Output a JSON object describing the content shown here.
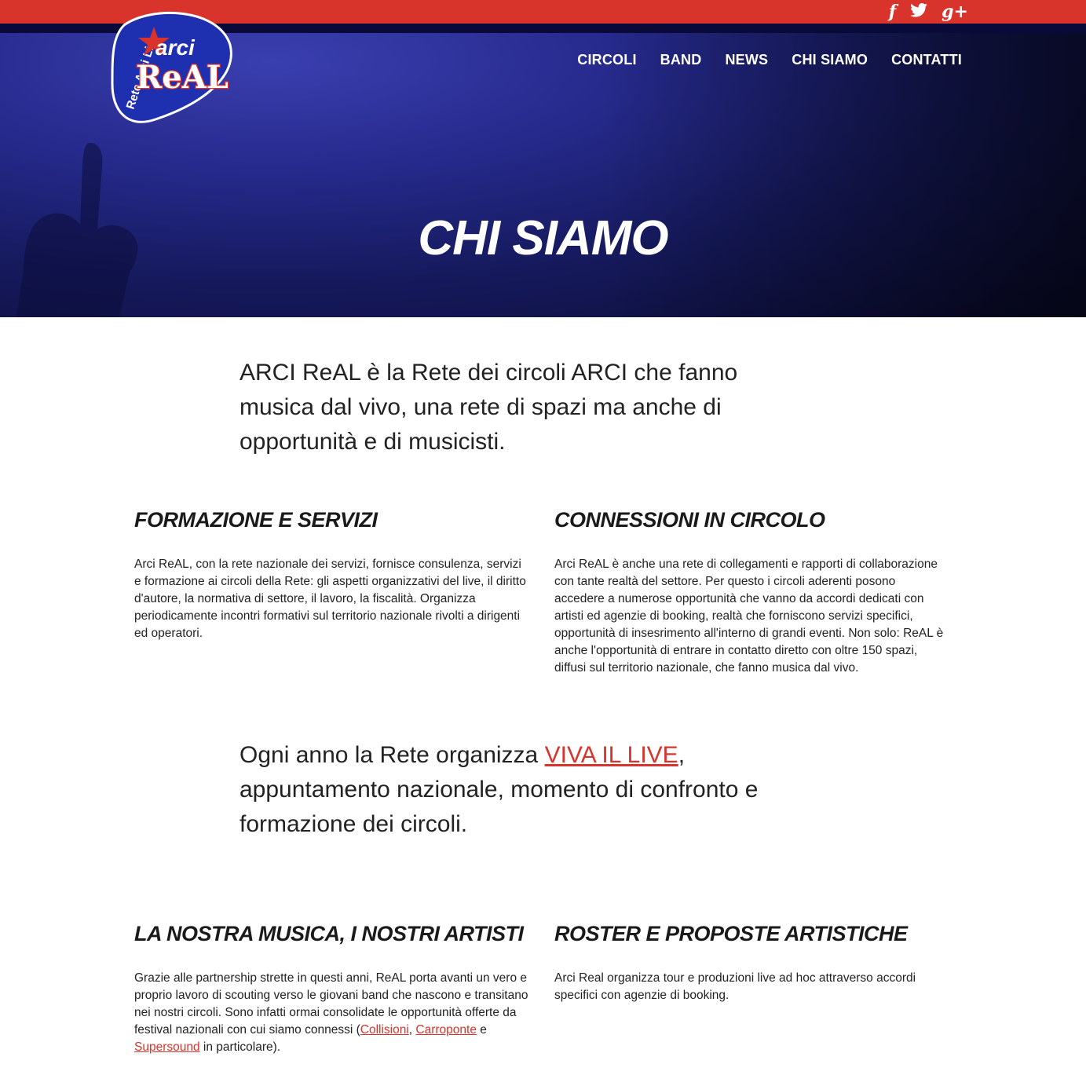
{
  "social": {
    "facebook": "f",
    "twitter": "🐦",
    "googleplus": "g+"
  },
  "logo": {
    "arci": "arci",
    "real": "ReAL",
    "ring_text": "Rete Arci Live"
  },
  "nav": [
    "CIRCOLI",
    "BAND",
    "NEWS",
    "CHI SIAMO",
    "CONTATTI"
  ],
  "hero": {
    "title": "CHI SIAMO"
  },
  "intro": "ARCI ReAL è la Rete dei circoli ARCI che fanno musica dal vivo, una rete di spazi ma anche di opportunità e di musicisti.",
  "sections": {
    "formazione": {
      "title": "FORMAZIONE E SERVIZI",
      "text": "Arci ReAL, con la rete nazionale dei servizi, fornisce consulenza, servizi e formazione ai circoli della Rete: gli aspetti organizzativi del live, il diritto d'autore, la normativa di settore, il lavoro, la fiscalità. Organizza periodicamente incontri formativi sul territorio nazionale rivolti a dirigenti ed operatori."
    },
    "connessioni": {
      "title": "CONNESSIONI IN CIRCOLO",
      "text": "Arci ReAL è anche una rete di collegamenti e rapporti di collaborazione con tante realtà del settore. Per questo i circoli aderenti posono accedere a numerose opportunità che vanno da accordi dedicati con artisti ed agenzie di booking, realtà che forniscono servizi specifici, opportunità di insesrimento all'interno di grandi eventi. Non solo: ReAL è anche l'opportunità di entrare in contatto diretto con oltre 150 spazi, diffusi sul territorio nazionale, che fanno musica dal vivo."
    },
    "musica": {
      "title": "LA NOSTRA MUSICA, I NOSTRI ARTISTI",
      "text_before": "Grazie alle partnership strette in questi anni, ReAL porta avanti un vero e proprio lavoro di scouting verso le giovani band che nascono e transitano nei nostri circoli. Sono infatti ormai consolidate le opportunità offerte da festival nazionali con cui siamo connessi (",
      "link1": "Collisioni",
      "sep1": ", ",
      "link2": "Carroponte",
      "sep2": " e ",
      "link3": "Supersound",
      "text_after": " in particolare)."
    },
    "roster": {
      "title": "ROSTER E PROPOSTE ARTISTICHE",
      "text": "Arci Real organizza tour e produzioni live ad hoc attraverso accordi specifici con agenzie di booking."
    }
  },
  "vivalive": {
    "before": "Ogni anno la Rete organizza ",
    "link": "VIVA IL LIVE",
    "after": ", appuntamento nazionale, momento di confronto e formazione dei circoli."
  },
  "colors": {
    "accent_red": "#d9342b",
    "hero_blue": "#262a8c",
    "dark_navy": "#0a0a3a"
  }
}
